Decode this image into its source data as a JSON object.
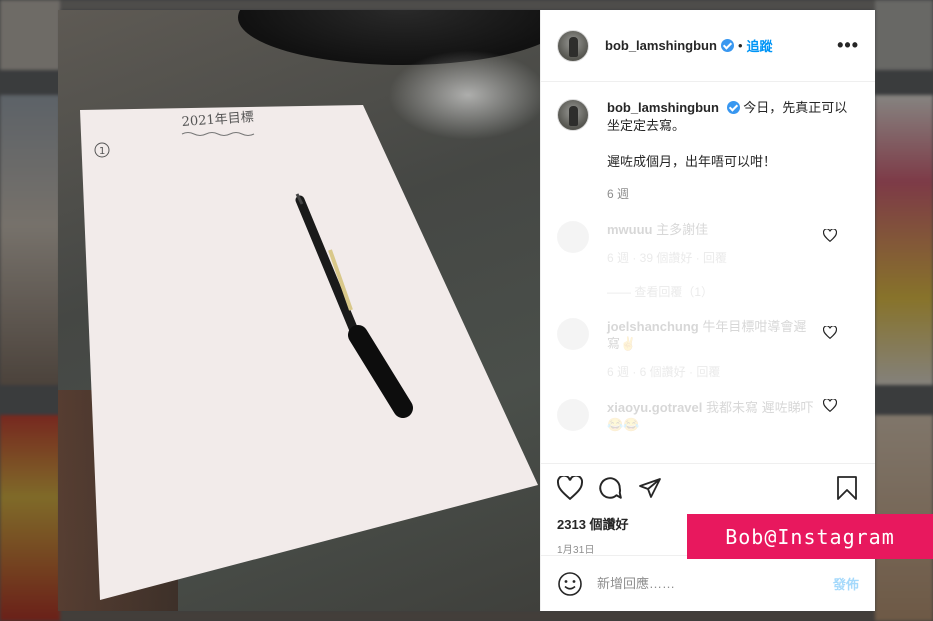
{
  "post": {
    "username": "bob_lamshingbun",
    "follow_label": "追蹤",
    "separator": "•",
    "more_label": "•••"
  },
  "caption": {
    "username": "bob_lamshingbun",
    "line1": "今日，先真正可以坐定定去寫。",
    "line2": "遲咗成個月，出年唔可以咁！",
    "time": "6 週"
  },
  "comments": [
    {
      "username": "mwuuu",
      "text": "主多謝佳",
      "meta": "6 週 · 39 個讚好 · 回覆",
      "replies": "—— 查看回覆（1）"
    },
    {
      "username": "joelshanchung",
      "text": "牛年目標咁導會遲寫✌",
      "meta": "6 週 · 6 個讚好 · 回覆"
    },
    {
      "username": "xiaoyu.gotravel",
      "text": "我都未寫 遲咗睇吓😂😂"
    }
  ],
  "photo": {
    "paper_title": "2021年目標",
    "paper_number": "1"
  },
  "actions": {
    "likes": "2313 個讚好",
    "date": "1月31日"
  },
  "composer": {
    "placeholder": "新增回應……",
    "post_label": "發佈"
  },
  "watermark": "Bob@Instagram",
  "colors": {
    "accent": "#0095f6",
    "verified": "#3897f0",
    "watermark_bg": "#e8185e"
  }
}
